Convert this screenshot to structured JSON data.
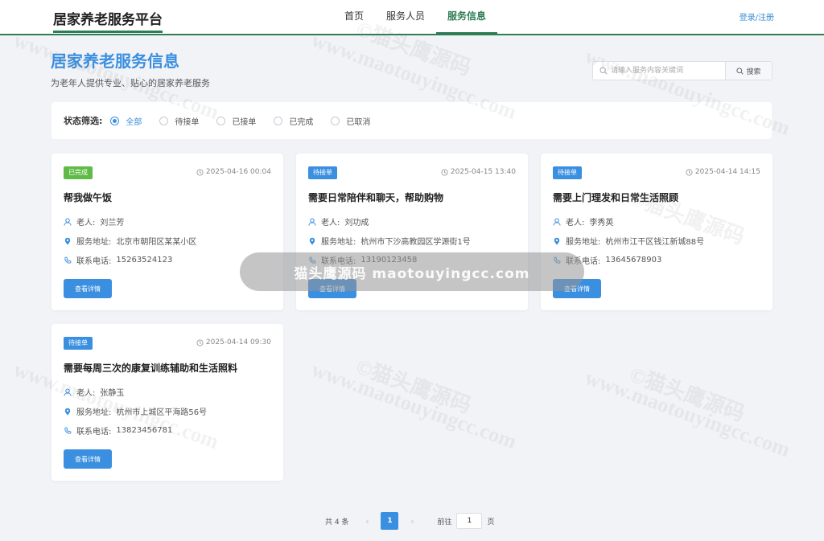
{
  "header": {
    "brand": "居家养老服务平台",
    "nav": [
      "首页",
      "服务人员",
      "服务信息"
    ],
    "login": "登录/注册"
  },
  "page": {
    "title": "居家养老服务信息",
    "subtitle": "为老年人提供专业、贴心的居家养老服务"
  },
  "search": {
    "placeholder": "请输入服务内容关键词",
    "button": "搜索"
  },
  "filter": {
    "label": "状态筛选:",
    "options": [
      "全部",
      "待接单",
      "已接单",
      "已完成",
      "已取消"
    ],
    "selected": "全部"
  },
  "labels": {
    "elder": "老人:",
    "address": "服务地址:",
    "phone": "联系电话:",
    "detail_button": "查看详情"
  },
  "cards": [
    {
      "status": "已完成",
      "time": "2025-04-16 00:04",
      "title": "帮我做午饭",
      "elder": "刘兰芳",
      "address": "北京市朝阳区某某小区",
      "phone": "15263524123"
    },
    {
      "status": "待接单",
      "time": "2025-04-15 13:40",
      "title": "需要日常陪伴和聊天，帮助购物",
      "elder": "刘功成",
      "address": "杭州市下沙高教园区学源街1号",
      "phone": "13190123458"
    },
    {
      "status": "待接单",
      "time": "2025-04-14 14:15",
      "title": "需要上门理发和日常生活照顾",
      "elder": "李秀英",
      "address": "杭州市江干区钱江新城88号",
      "phone": "13645678903"
    },
    {
      "status": "待接单",
      "time": "2025-04-14 09:30",
      "title": "需要每周三次的康复训练辅助和生活照料",
      "elder": "张静玉",
      "address": "杭州市上城区平海路56号",
      "phone": "13823456781"
    }
  ],
  "pagination": {
    "total": "共 4 条",
    "current": "1",
    "goto_label": "前往",
    "goto_value": "1",
    "page_suffix": "页"
  },
  "watermark": {
    "text": "www.maotouyingcc.com",
    "text_cn": "©猫头鹰源码",
    "bar": "猫头鹰源码 maotouyingcc.com"
  },
  "colors": {
    "accent": "#3b8fe0",
    "brand_green": "#2e7d55",
    "done": "#5fbb46"
  }
}
